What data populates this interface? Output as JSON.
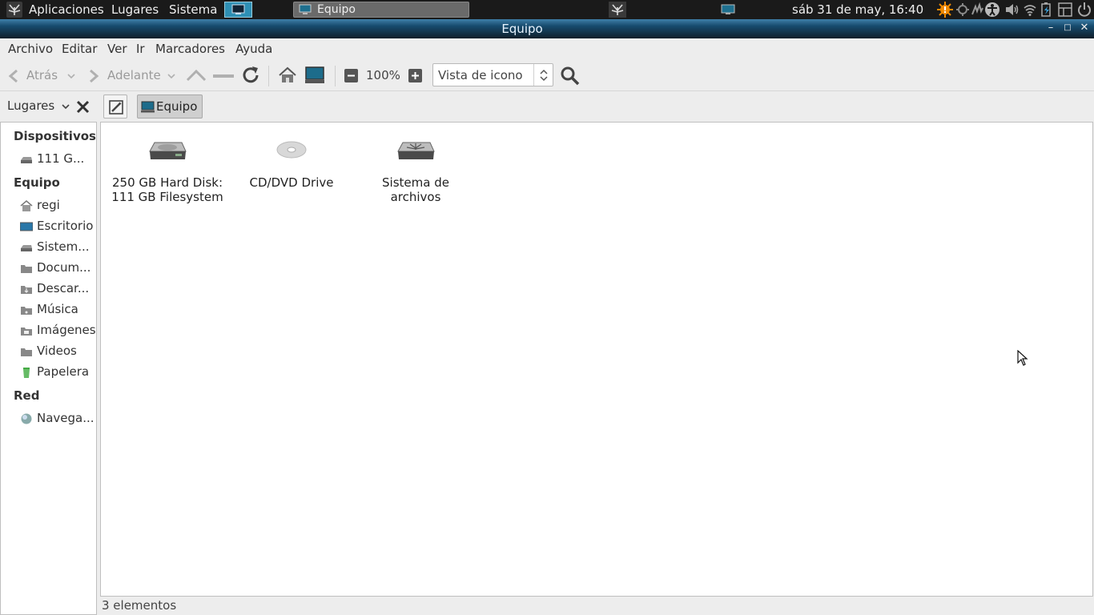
{
  "top_panel": {
    "menus": [
      "Aplicaciones",
      "Lugares",
      "Sistema"
    ],
    "task_label": "Equipo",
    "clock": "sáb 31 de may, 16:40"
  },
  "window": {
    "title": "Equipo"
  },
  "menubar": [
    "Archivo",
    "Editar",
    "Ver",
    "Ir",
    "Marcadores",
    "Ayuda"
  ],
  "toolbar": {
    "back_label": "Atrás",
    "forward_label": "Adelante",
    "zoom": "100%",
    "view_mode": "Vista de icono"
  },
  "locationbar": {
    "pane_label": "Lugares",
    "path_button": "Equipo"
  },
  "sidebar": {
    "sections": [
      {
        "title": "Dispositivos",
        "items": [
          {
            "label": "111 G...",
            "icon": "drive-icon"
          }
        ]
      },
      {
        "title": "Equipo",
        "items": [
          {
            "label": "regi",
            "icon": "home-icon"
          },
          {
            "label": "Escritorio",
            "icon": "desktop-icon"
          },
          {
            "label": "Sistem...",
            "icon": "drive-icon"
          },
          {
            "label": "Docum...",
            "icon": "folder-icon"
          },
          {
            "label": "Descar...",
            "icon": "download-folder-icon"
          },
          {
            "label": "Música",
            "icon": "music-folder-icon"
          },
          {
            "label": "Imágenes",
            "icon": "pictures-folder-icon"
          },
          {
            "label": "Videos",
            "icon": "videos-folder-icon"
          },
          {
            "label": "Papelera",
            "icon": "trash-icon"
          }
        ]
      },
      {
        "title": "Red",
        "items": [
          {
            "label": "Navega...",
            "icon": "network-globe-icon"
          }
        ]
      }
    ]
  },
  "files": [
    {
      "label": "250 GB Hard Disk: 111 GB Filesystem",
      "icon": "hard-disk-icon"
    },
    {
      "label": "CD/DVD Drive",
      "icon": "optical-disc-icon"
    },
    {
      "label": "Sistema de archivos",
      "icon": "filesystem-icon"
    }
  ],
  "status": "3 elementos",
  "colors": {
    "titlebar_accent": "#174b6e",
    "panel_bg": "#1a1a1a",
    "tray_orange": "#f08a00"
  }
}
